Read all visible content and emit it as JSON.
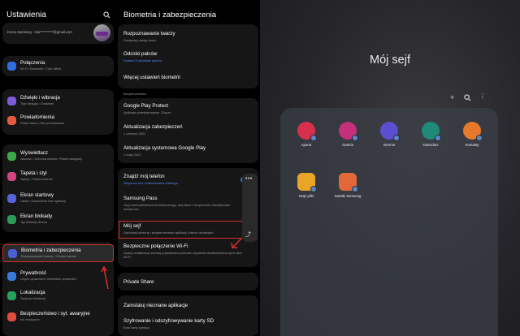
{
  "left": {
    "title": "Ustawienia",
    "account": "Konto Samsung  ·  mai**********@gmail.com",
    "items": [
      {
        "title": "Połączenia",
        "sub": "Wi-Fi  •  Bluetooth  •  Tryb offline",
        "color": "#2f6de3"
      },
      {
        "title": "Dźwięki i wibracja",
        "sub": "Tryb dźwięku  •  Dzwonek",
        "color": "#7b5cd6"
      },
      {
        "title": "Powiadomienia",
        "sub": "Pasek stanu  •  Nie przeszkadzać",
        "color": "#e45a3d"
      },
      {
        "title": "Wyświetlacz",
        "sub": "Jasność  •  Ochrona wzroku  •  Pasek nawigacji",
        "color": "#3ea84a"
      },
      {
        "title": "Tapeta i styl",
        "sub": "Tapety  •  Paleta kolorów",
        "color": "#d0467d"
      },
      {
        "title": "Ekran startowy",
        "sub": "Układ  •  Oznaczenia ikon aplikacji",
        "color": "#5763d8"
      },
      {
        "title": "Ekran blokady",
        "sub": "Typ blokady ekranu",
        "color": "#2e9a57"
      },
      {
        "title": "Biometria i zabezpieczenia",
        "sub": "Rozpoznawanie twarzy  •  Odciski palców",
        "color": "#4c5fd1"
      },
      {
        "title": "Prywatność",
        "sub": "Użycie uprawnień  •  Menedżer uprawnień",
        "color": "#3a7ad8"
      },
      {
        "title": "Lokalizacja",
        "sub": "Żądania lokalizacji",
        "color": "#25a35a"
      },
      {
        "title": "Bezpieczeństwo i syt. awaryjne",
        "sub": "Inf. medyczne",
        "color": "#e04b3b"
      }
    ]
  },
  "mid": {
    "title": "Biometria i zabezpieczenia",
    "bio": [
      {
        "title": "Rozpoznawanie twarzy",
        "sub": "Zarejestruj swoją twarz."
      },
      {
        "title": "Odciski palców",
        "sub": "Dodano 5 odcisków palców"
      },
      {
        "title": "Więcej ustawień biometrii",
        "sub": ""
      }
    ],
    "security_label": "Bezpieczeństwo",
    "security": [
      {
        "title": "Google Play Protect",
        "sub": "Aplikacje przeskanowane: 3 łącza"
      },
      {
        "title": "Aktualizacja zabezpieczeń",
        "sub": "1 czerwca 2022"
      },
      {
        "title": "Aktualizacja systemowa Google Play",
        "sub": "1 maja 2022"
      }
    ],
    "more": [
      {
        "title": "Znajdź mój telefon",
        "sub": "Włączono bez Odblokowania zdalnego"
      },
      {
        "title": "Samsung Pass",
        "sub": "Użyj uwierzytelnienia biometrycznego, aby łatwo i bezpiecznie zweryfikować tożsamość."
      },
      {
        "title": "Mój sejf",
        "sub": "Zachowaj ochronę i bezpieczeństwo aplikacji i plików osobistych"
      },
      {
        "title": "Bezpieczne połączenie Wi-Fi",
        "sub": "Zyskuj dodatkową ochronę prywatności podczas używania niezabezpieczonych sieci Wi-Fi."
      }
    ],
    "private_share": "Private Share",
    "bottom": [
      {
        "title": "Zainstaluj nieznane aplikacje",
        "sub": ""
      },
      {
        "title": "Szyfrowanie i odszyfrowywanie karty SD",
        "sub": "Brak karty pamięci"
      }
    ]
  },
  "right": {
    "title": "Mój sejf",
    "apps": [
      {
        "name": "Aparat",
        "color": "#d6304c"
      },
      {
        "name": "Galeria",
        "color": "#c5307a"
      },
      {
        "name": "Internet",
        "color": "#5a4fd1"
      },
      {
        "name": "Kalendarz",
        "color": "#1f8a77"
      },
      {
        "name": "Kontakty",
        "color": "#e8782a"
      },
      {
        "name": "Moje pliki",
        "color": "#e9a626"
      },
      {
        "name": "Notatki Samsung",
        "color": "#e2683a"
      }
    ]
  }
}
